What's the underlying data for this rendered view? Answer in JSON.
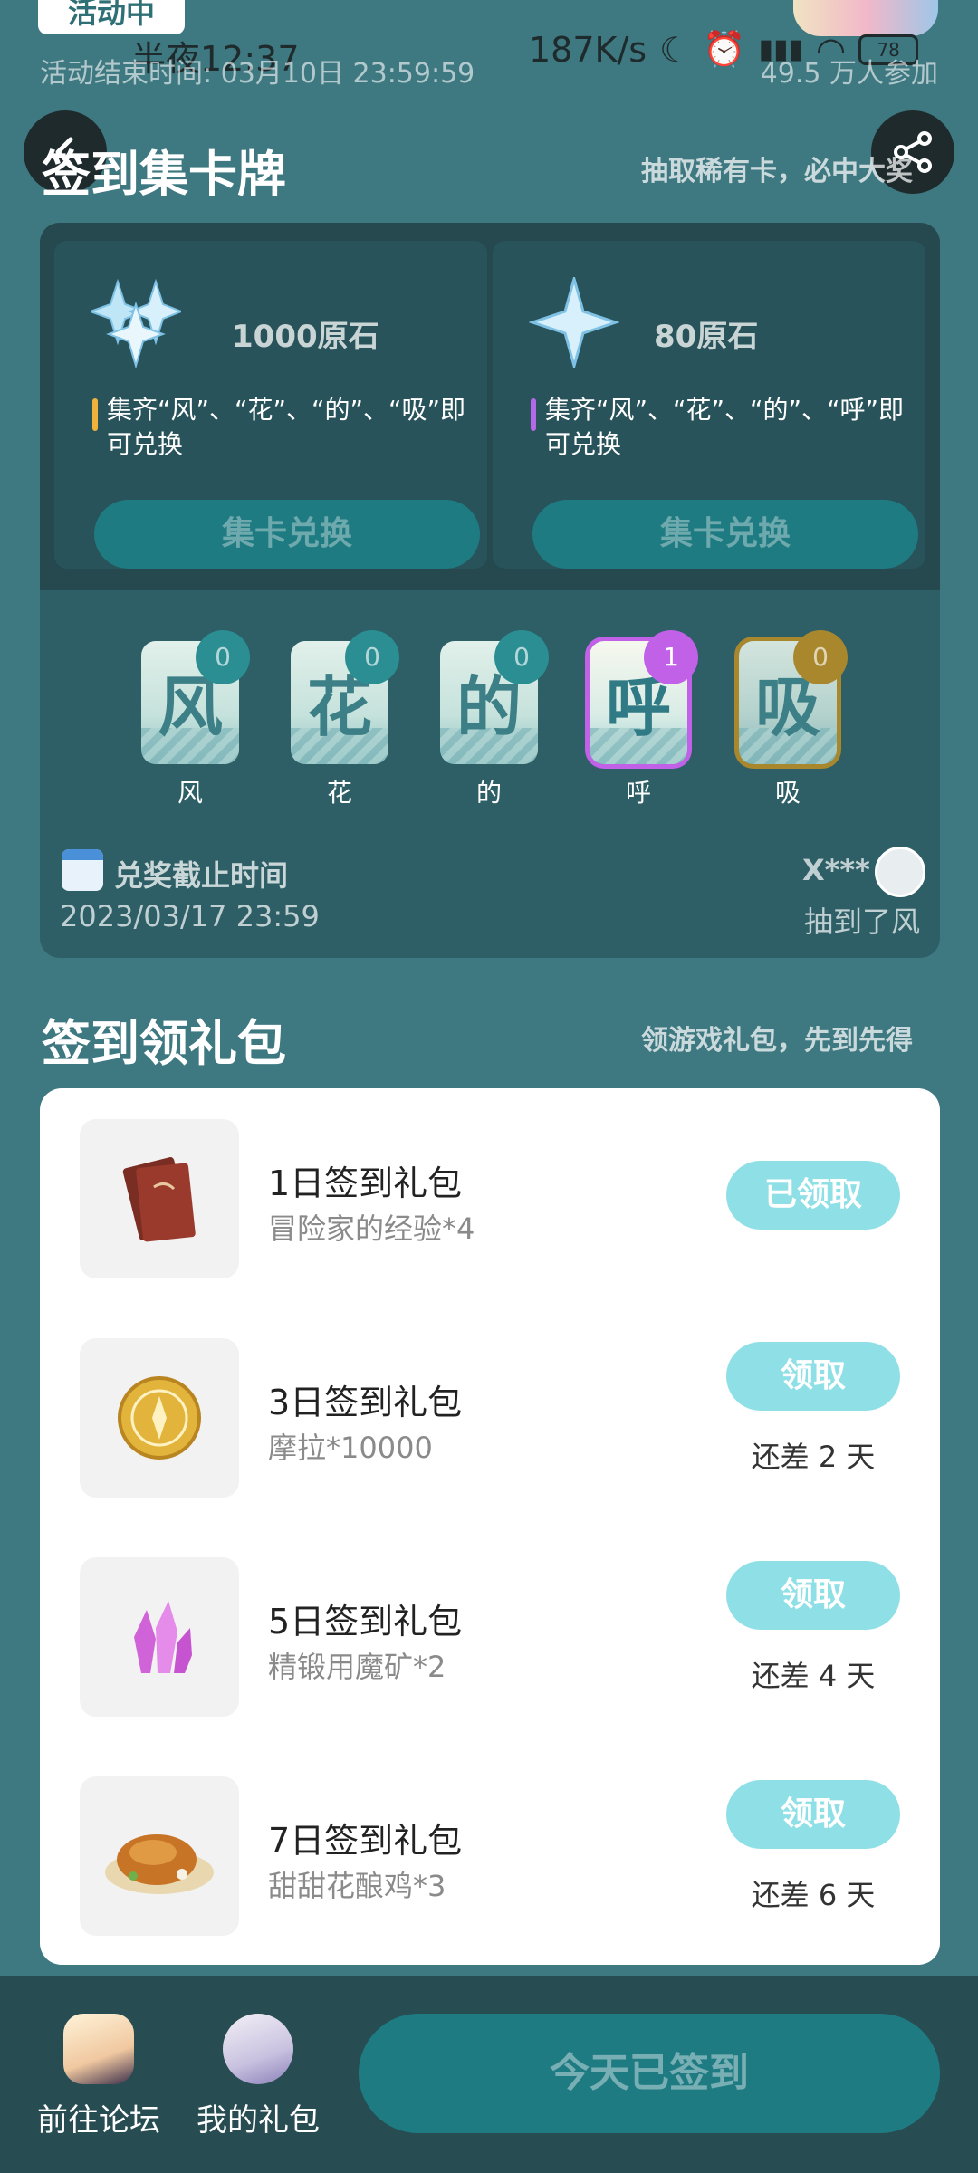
{
  "status_bar": {
    "time": "半夜12:37",
    "network_speed": "187K/s",
    "battery": "78"
  },
  "activity": {
    "tag": "活动中",
    "end_time": "活动结束时间: 03月10日 23:59:59",
    "participants": "49.5 万人参加"
  },
  "card_section": {
    "title": "签到集卡牌",
    "subtitle": "抽取稀有卡，必中大奖",
    "rewards": [
      {
        "amount": "1000原石",
        "description": "集齐“风”、“花”、“的”、“吸”即可兑换",
        "button": "集卡兑换",
        "accent": "#f0b23a"
      },
      {
        "amount": "80原石",
        "description": "集齐“风”、“花”、“的”、“呼”即可兑换",
        "button": "集卡兑换",
        "accent": "#b46ae8"
      }
    ],
    "cards": [
      {
        "glyph": "风",
        "label": "风",
        "count": "0"
      },
      {
        "glyph": "花",
        "label": "花",
        "count": "0"
      },
      {
        "glyph": "的",
        "label": "的",
        "count": "0"
      },
      {
        "glyph": "呼",
        "label": "呼",
        "count": "1"
      },
      {
        "glyph": "吸",
        "label": "吸",
        "count": "0"
      }
    ],
    "deadline_label": "兑奖截止时间",
    "deadline_value": "2023/03/17 23:59",
    "winner_name": "X***",
    "winner_text": "抽到了风"
  },
  "gift_section": {
    "title": "签到领礼包",
    "subtitle": "领游戏礼包，先到先得",
    "gifts": [
      {
        "title": "1日签到礼包",
        "item": "冒险家的经验*4",
        "button": "已领取",
        "days_left": ""
      },
      {
        "title": "3日签到礼包",
        "item": "摩拉*10000",
        "button": "领取",
        "days_left": "还差 2 天"
      },
      {
        "title": "5日签到礼包",
        "item": "精锻用魔矿*2",
        "button": "领取",
        "days_left": "还差 4 天"
      },
      {
        "title": "7日签到礼包",
        "item": "甜甜花酿鸡*3",
        "button": "领取",
        "days_left": "还差 6 天"
      }
    ]
  },
  "bottom_bar": {
    "forum_label": "前往论坛",
    "gifts_label": "我的礼包",
    "sign_button": "今天已签到"
  },
  "colors": {
    "background": "#3e7880",
    "button_teal": "#1f7b82",
    "claim_button": "#8fe0e6",
    "active_card": "#c061e8",
    "gold_card": "#c9a33a"
  }
}
